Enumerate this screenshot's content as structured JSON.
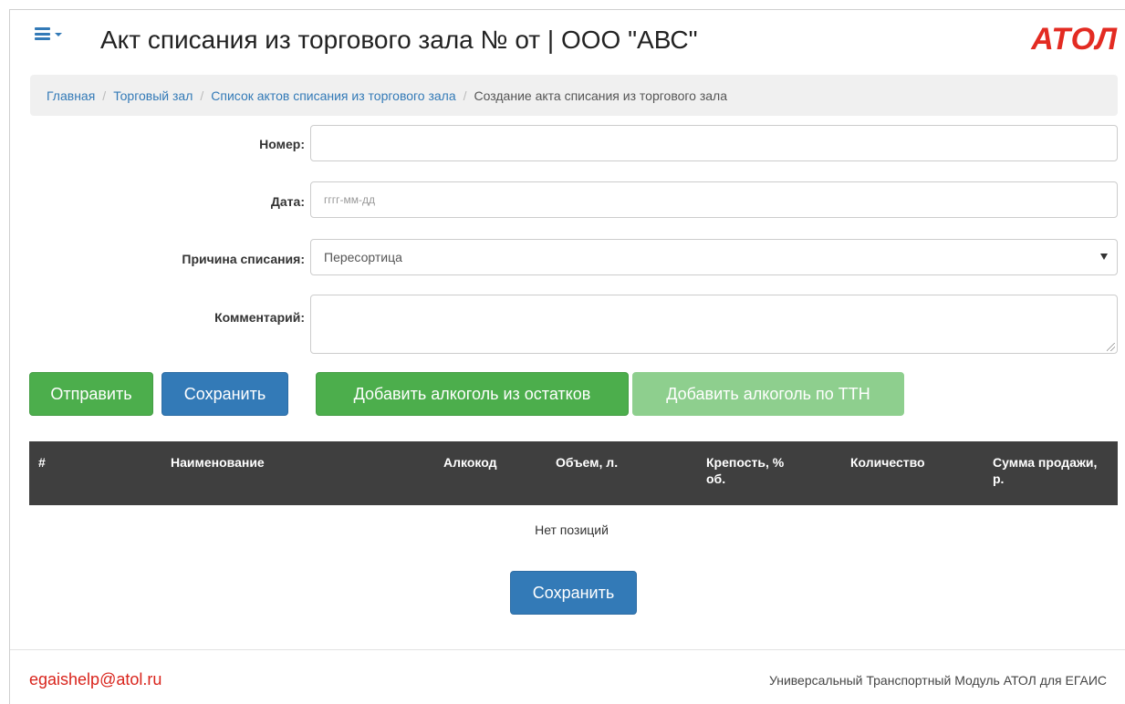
{
  "header": {
    "title": "Акт списания из торгового зала № от | ООО \"АВС\"",
    "logo_text": "АТОЛ",
    "menu_icon": "hamburger-menu-icon"
  },
  "breadcrumb": [
    "Главная",
    "Торговый зал",
    "Список актов списания из торгового зала",
    "Создание акта списания из торгового зала"
  ],
  "form": {
    "number_label": "Номер:",
    "number_value": "",
    "date_label": "Дата:",
    "date_placeholder": "гггг-мм-дд",
    "reason_label": "Причина списания:",
    "reason_value": "Пересортица",
    "comment_label": "Комментарий:",
    "comment_value": ""
  },
  "actions": {
    "send": "Отправить",
    "save": "Сохранить",
    "add_from_stock": "Добавить алкоголь из остатков",
    "add_by_ttn": "Добавить алкоголь по ТТН"
  },
  "table": {
    "columns": [
      "#",
      "Наименование",
      "Алкокод",
      "Объем, л.",
      "Крепость, % об.",
      "Количество",
      "Сумма продажи, р."
    ],
    "empty_text": "Нет позиций"
  },
  "bottom_save": "Сохранить",
  "footer": {
    "email": "egaishelp@atol.ru",
    "product_name": "Универсальный Транспортный Модуль АТОЛ для ЕГАИС"
  },
  "colors": {
    "primary_blue": "#337ab7",
    "success_green": "#4cae4c",
    "brand_red": "#e32b22",
    "table_header": "#3f3f3f"
  }
}
